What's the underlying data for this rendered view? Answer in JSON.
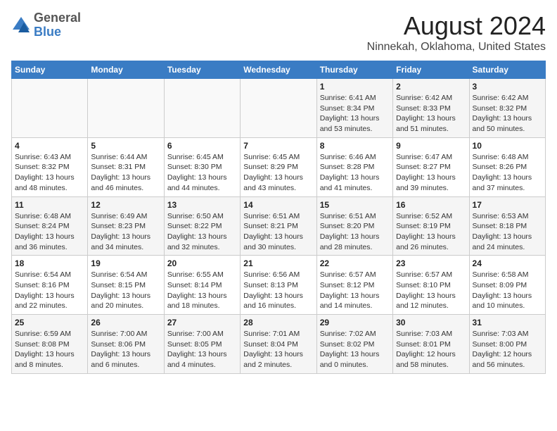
{
  "logo": {
    "general": "General",
    "blue": "Blue"
  },
  "title": "August 2024",
  "subtitle": "Ninnekah, Oklahoma, United States",
  "days_of_week": [
    "Sunday",
    "Monday",
    "Tuesday",
    "Wednesday",
    "Thursday",
    "Friday",
    "Saturday"
  ],
  "weeks": [
    [
      {
        "day": "",
        "info": ""
      },
      {
        "day": "",
        "info": ""
      },
      {
        "day": "",
        "info": ""
      },
      {
        "day": "",
        "info": ""
      },
      {
        "day": "1",
        "info": "Sunrise: 6:41 AM\nSunset: 8:34 PM\nDaylight: 13 hours\nand 53 minutes."
      },
      {
        "day": "2",
        "info": "Sunrise: 6:42 AM\nSunset: 8:33 PM\nDaylight: 13 hours\nand 51 minutes."
      },
      {
        "day": "3",
        "info": "Sunrise: 6:42 AM\nSunset: 8:32 PM\nDaylight: 13 hours\nand 50 minutes."
      }
    ],
    [
      {
        "day": "4",
        "info": "Sunrise: 6:43 AM\nSunset: 8:32 PM\nDaylight: 13 hours\nand 48 minutes."
      },
      {
        "day": "5",
        "info": "Sunrise: 6:44 AM\nSunset: 8:31 PM\nDaylight: 13 hours\nand 46 minutes."
      },
      {
        "day": "6",
        "info": "Sunrise: 6:45 AM\nSunset: 8:30 PM\nDaylight: 13 hours\nand 44 minutes."
      },
      {
        "day": "7",
        "info": "Sunrise: 6:45 AM\nSunset: 8:29 PM\nDaylight: 13 hours\nand 43 minutes."
      },
      {
        "day": "8",
        "info": "Sunrise: 6:46 AM\nSunset: 8:28 PM\nDaylight: 13 hours\nand 41 minutes."
      },
      {
        "day": "9",
        "info": "Sunrise: 6:47 AM\nSunset: 8:27 PM\nDaylight: 13 hours\nand 39 minutes."
      },
      {
        "day": "10",
        "info": "Sunrise: 6:48 AM\nSunset: 8:26 PM\nDaylight: 13 hours\nand 37 minutes."
      }
    ],
    [
      {
        "day": "11",
        "info": "Sunrise: 6:48 AM\nSunset: 8:24 PM\nDaylight: 13 hours\nand 36 minutes."
      },
      {
        "day": "12",
        "info": "Sunrise: 6:49 AM\nSunset: 8:23 PM\nDaylight: 13 hours\nand 34 minutes."
      },
      {
        "day": "13",
        "info": "Sunrise: 6:50 AM\nSunset: 8:22 PM\nDaylight: 13 hours\nand 32 minutes."
      },
      {
        "day": "14",
        "info": "Sunrise: 6:51 AM\nSunset: 8:21 PM\nDaylight: 13 hours\nand 30 minutes."
      },
      {
        "day": "15",
        "info": "Sunrise: 6:51 AM\nSunset: 8:20 PM\nDaylight: 13 hours\nand 28 minutes."
      },
      {
        "day": "16",
        "info": "Sunrise: 6:52 AM\nSunset: 8:19 PM\nDaylight: 13 hours\nand 26 minutes."
      },
      {
        "day": "17",
        "info": "Sunrise: 6:53 AM\nSunset: 8:18 PM\nDaylight: 13 hours\nand 24 minutes."
      }
    ],
    [
      {
        "day": "18",
        "info": "Sunrise: 6:54 AM\nSunset: 8:16 PM\nDaylight: 13 hours\nand 22 minutes."
      },
      {
        "day": "19",
        "info": "Sunrise: 6:54 AM\nSunset: 8:15 PM\nDaylight: 13 hours\nand 20 minutes."
      },
      {
        "day": "20",
        "info": "Sunrise: 6:55 AM\nSunset: 8:14 PM\nDaylight: 13 hours\nand 18 minutes."
      },
      {
        "day": "21",
        "info": "Sunrise: 6:56 AM\nSunset: 8:13 PM\nDaylight: 13 hours\nand 16 minutes."
      },
      {
        "day": "22",
        "info": "Sunrise: 6:57 AM\nSunset: 8:12 PM\nDaylight: 13 hours\nand 14 minutes."
      },
      {
        "day": "23",
        "info": "Sunrise: 6:57 AM\nSunset: 8:10 PM\nDaylight: 13 hours\nand 12 minutes."
      },
      {
        "day": "24",
        "info": "Sunrise: 6:58 AM\nSunset: 8:09 PM\nDaylight: 13 hours\nand 10 minutes."
      }
    ],
    [
      {
        "day": "25",
        "info": "Sunrise: 6:59 AM\nSunset: 8:08 PM\nDaylight: 13 hours\nand 8 minutes."
      },
      {
        "day": "26",
        "info": "Sunrise: 7:00 AM\nSunset: 8:06 PM\nDaylight: 13 hours\nand 6 minutes."
      },
      {
        "day": "27",
        "info": "Sunrise: 7:00 AM\nSunset: 8:05 PM\nDaylight: 13 hours\nand 4 minutes."
      },
      {
        "day": "28",
        "info": "Sunrise: 7:01 AM\nSunset: 8:04 PM\nDaylight: 13 hours\nand 2 minutes."
      },
      {
        "day": "29",
        "info": "Sunrise: 7:02 AM\nSunset: 8:02 PM\nDaylight: 13 hours\nand 0 minutes."
      },
      {
        "day": "30",
        "info": "Sunrise: 7:03 AM\nSunset: 8:01 PM\nDaylight: 12 hours\nand 58 minutes."
      },
      {
        "day": "31",
        "info": "Sunrise: 7:03 AM\nSunset: 8:00 PM\nDaylight: 12 hours\nand 56 minutes."
      }
    ]
  ]
}
